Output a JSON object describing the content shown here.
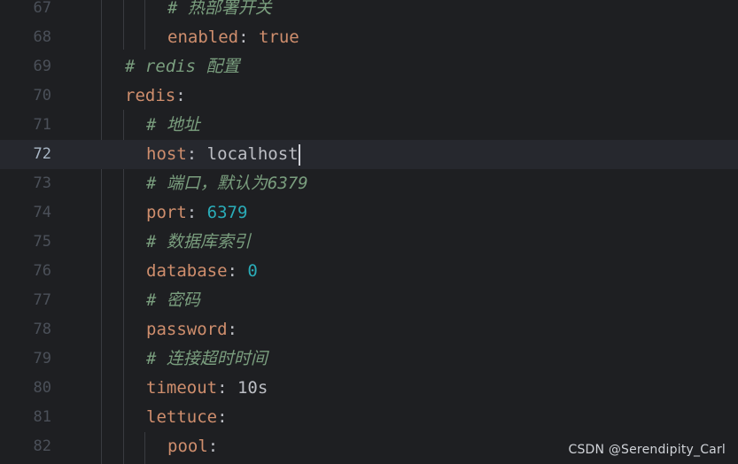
{
  "editor": {
    "lines": [
      {
        "num": "67",
        "indent": 3,
        "type": "comment",
        "text": "# 热部署开关"
      },
      {
        "num": "68",
        "indent": 3,
        "type": "kv",
        "key": "enabled",
        "sep": ": ",
        "value": "true",
        "vtype": "bool"
      },
      {
        "num": "69",
        "indent": 1,
        "type": "comment",
        "text": "# redis 配置"
      },
      {
        "num": "70",
        "indent": 1,
        "type": "kv",
        "key": "redis",
        "sep": ":",
        "value": "",
        "vtype": "none"
      },
      {
        "num": "71",
        "indent": 2,
        "type": "comment",
        "text": "# 地址"
      },
      {
        "num": "72",
        "indent": 2,
        "type": "kv",
        "key": "host",
        "sep": ": ",
        "value": "localhost",
        "vtype": "str",
        "current": true
      },
      {
        "num": "73",
        "indent": 2,
        "type": "comment",
        "text": "# 端口，默认为6379"
      },
      {
        "num": "74",
        "indent": 2,
        "type": "kv",
        "key": "port",
        "sep": ": ",
        "value": "6379",
        "vtype": "num"
      },
      {
        "num": "75",
        "indent": 2,
        "type": "comment",
        "text": "# 数据库索引"
      },
      {
        "num": "76",
        "indent": 2,
        "type": "kv",
        "key": "database",
        "sep": ": ",
        "value": "0",
        "vtype": "num"
      },
      {
        "num": "77",
        "indent": 2,
        "type": "comment",
        "text": "# 密码"
      },
      {
        "num": "78",
        "indent": 2,
        "type": "kv",
        "key": "password",
        "sep": ":",
        "value": "",
        "vtype": "none"
      },
      {
        "num": "79",
        "indent": 2,
        "type": "comment",
        "text": "# 连接超时时间"
      },
      {
        "num": "80",
        "indent": 2,
        "type": "kv",
        "key": "timeout",
        "sep": ": ",
        "value": "10s",
        "vtype": "str"
      },
      {
        "num": "81",
        "indent": 2,
        "type": "kv",
        "key": "lettuce",
        "sep": ":",
        "value": "",
        "vtype": "none"
      },
      {
        "num": "82",
        "indent": 3,
        "type": "kv",
        "key": "pool",
        "sep": ":",
        "value": "",
        "vtype": "none"
      }
    ]
  },
  "watermark": "CSDN @Serendipity_Carl",
  "colors": {
    "background": "#1e1f22",
    "current_line": "#26282e",
    "key": "#cf8e6d",
    "comment": "#7a9e7e",
    "number": "#2aacb8",
    "text": "#bcbec4"
  }
}
